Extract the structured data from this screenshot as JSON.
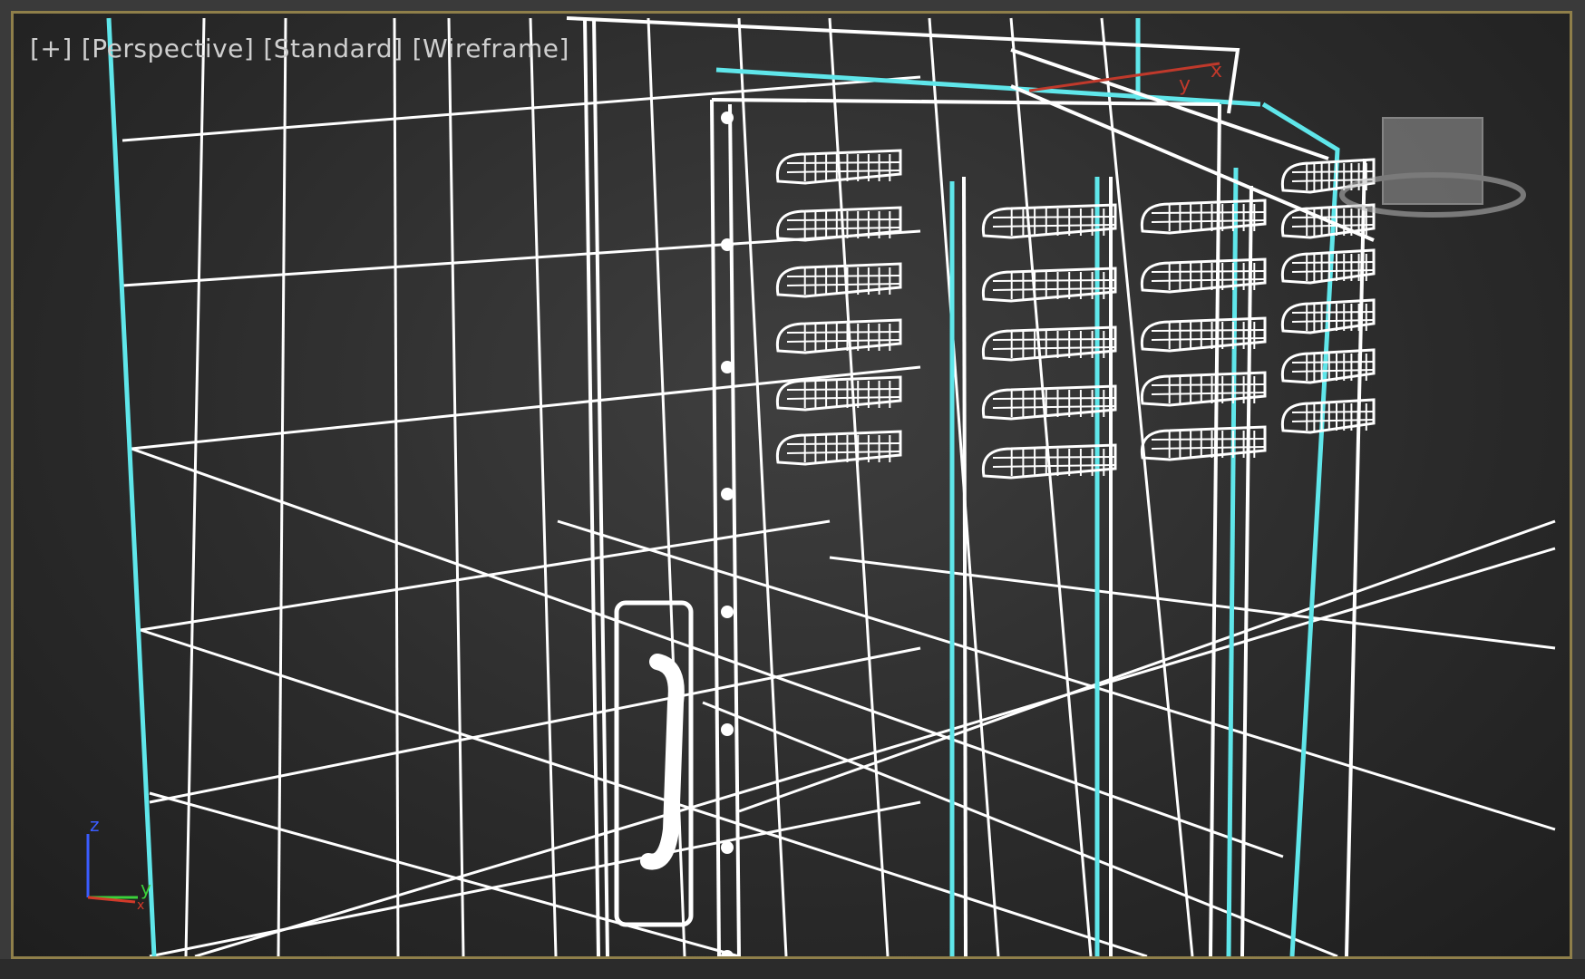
{
  "viewport": {
    "labels": [
      "[+]",
      "[Perspective]",
      "[Standard]",
      "[Wireframe]"
    ],
    "active_border_color": "#8f7f4a",
    "wire_color": "#ffffff",
    "selection_color": "#5fe6ea"
  },
  "axis_tripod": {
    "z_label": "z",
    "y_label": "y",
    "x_label": "x",
    "z_color": "#3a5cff",
    "y_color": "#3bd13b",
    "x_color": "#d23a2a"
  },
  "gizmo": {
    "x_label": "x",
    "y_label": "y",
    "x_color": "#c0392b"
  },
  "icons": [
    "viewcube-icon",
    "axis-tripod-icon"
  ]
}
